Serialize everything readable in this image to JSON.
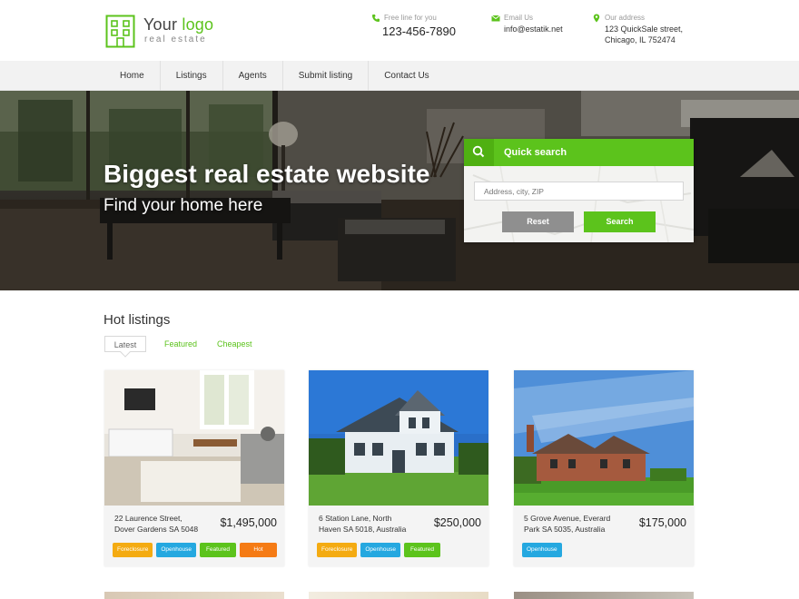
{
  "logo": {
    "title_main": "Your ",
    "title_accent": "logo",
    "subtitle": "real estate"
  },
  "contacts": {
    "phone": {
      "label": "Free line for you",
      "value": "123-456-7890"
    },
    "email": {
      "label": "Email Us",
      "value": "info@estatik.net"
    },
    "address": {
      "label": "Our address",
      "line1": "123 QuickSale street,",
      "line2": "Chicago, IL 752474"
    }
  },
  "nav": {
    "items": [
      "Home",
      "Listings",
      "Agents",
      "Submit listing",
      "Contact Us"
    ]
  },
  "hero": {
    "title": "Biggest real estate website",
    "subtitle": "Find your home here"
  },
  "quick_search": {
    "title": "Quick search",
    "placeholder": "Address, city, ZIP",
    "reset_label": "Reset",
    "search_label": "Search"
  },
  "listings": {
    "title": "Hot listings",
    "tabs": [
      "Latest",
      "Featured",
      "Cheapest"
    ],
    "cards": [
      {
        "address_line1": "22 Laurence Street,",
        "address_line2": "Dover Gardens SA 5048",
        "price": "$1,495,000",
        "badges": [
          "Foreclosure",
          "Openhouse",
          "Featured",
          "Hot"
        ]
      },
      {
        "address_line1": "6 Station Lane, North",
        "address_line2": "Haven SA 5018, Australia",
        "price": "$250,000",
        "badges": [
          "Foreclosure",
          "Openhouse",
          "Featured"
        ]
      },
      {
        "address_line1": "5 Grove Avenue, Everard",
        "address_line2": "Park SA 5035, Australia",
        "price": "$175,000",
        "badges": [
          "Openhouse"
        ]
      }
    ]
  },
  "colors": {
    "accent": "#5cc31c",
    "foreclosure": "#f4ab12",
    "openhouse": "#25a8e0",
    "featured": "#5cc31c",
    "hot": "#f57b15"
  }
}
